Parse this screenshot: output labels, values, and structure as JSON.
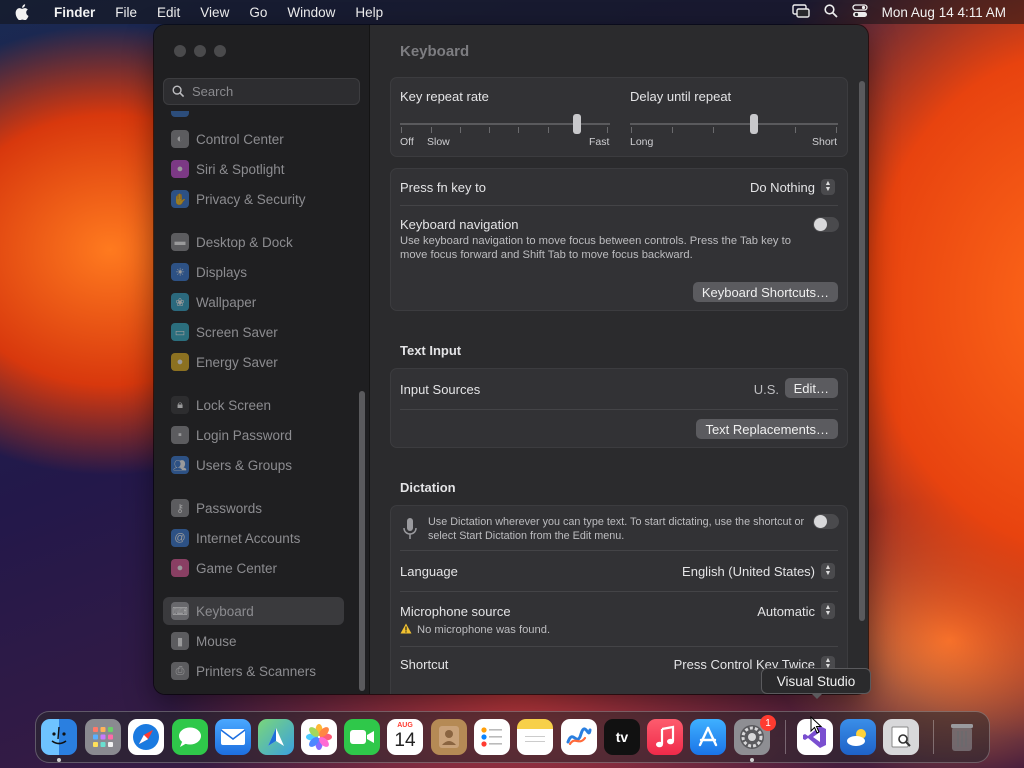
{
  "menubar": {
    "app": "Finder",
    "items": [
      "File",
      "Edit",
      "View",
      "Go",
      "Window",
      "Help"
    ],
    "clock": "Mon Aug 14  4:11 AM"
  },
  "sidebar": {
    "search_placeholder": "Search",
    "items": [
      {
        "label": "Control Center",
        "icon": "control-center-icon",
        "color": "#8e8e93"
      },
      {
        "label": "Siri & Spotlight",
        "icon": "siri-icon",
        "color": "#c84fd8"
      },
      {
        "label": "Privacy & Security",
        "icon": "hand-icon",
        "color": "#3a7bd5"
      },
      {
        "label": "Desktop & Dock",
        "icon": "dock-icon",
        "color": "#8e8e93"
      },
      {
        "label": "Displays",
        "icon": "sun-icon",
        "color": "#3a7bd5"
      },
      {
        "label": "Wallpaper",
        "icon": "wallpaper-icon",
        "color": "#35a7c9"
      },
      {
        "label": "Screen Saver",
        "icon": "screen-saver-icon",
        "color": "#35b0c9"
      },
      {
        "label": "Energy Saver",
        "icon": "bulb-icon",
        "color": "#e6b422"
      },
      {
        "label": "Lock Screen",
        "icon": "lock-icon",
        "color": "#3a3a3c"
      },
      {
        "label": "Login Password",
        "icon": "login-password-icon",
        "color": "#8e8e93"
      },
      {
        "label": "Users & Groups",
        "icon": "users-icon",
        "color": "#3a7bd5"
      },
      {
        "label": "Passwords",
        "icon": "key-icon",
        "color": "#8e8e93"
      },
      {
        "label": "Internet Accounts",
        "icon": "at-icon",
        "color": "#3a7bd5"
      },
      {
        "label": "Game Center",
        "icon": "game-center-icon",
        "color": "#e05a9a"
      },
      {
        "label": "Keyboard",
        "icon": "keyboard-icon",
        "color": "#8e8e93"
      },
      {
        "label": "Mouse",
        "icon": "mouse-icon",
        "color": "#8e8e93"
      },
      {
        "label": "Printers & Scanners",
        "icon": "printer-icon",
        "color": "#8e8e93"
      }
    ]
  },
  "content": {
    "title": "Keyboard",
    "key_repeat": {
      "label": "Key repeat rate",
      "off": "Off",
      "slow": "Slow",
      "fast": "Fast"
    },
    "delay_repeat": {
      "label": "Delay until repeat",
      "long": "Long",
      "short": "Short"
    },
    "fn_key": {
      "label": "Press fn key to",
      "value": "Do Nothing"
    },
    "keyboard_nav": {
      "label": "Keyboard navigation",
      "description": "Use keyboard navigation to move focus between controls. Press the Tab key to move focus forward and Shift Tab to move focus backward."
    },
    "shortcuts_button": "Keyboard Shortcuts…",
    "text_input": {
      "heading": "Text Input",
      "input_sources_label": "Input Sources",
      "input_sources_value": "U.S.",
      "edit_button": "Edit…",
      "replacements_button": "Text Replacements…"
    },
    "dictation": {
      "heading": "Dictation",
      "description": "Use Dictation wherever you can type text. To start dictating, use the shortcut or select Start Dictation from the Edit menu.",
      "language_label": "Language",
      "language_value": "English (United States)",
      "mic_label": "Microphone source",
      "mic_value": "Automatic",
      "mic_warning": "No microphone was found.",
      "shortcut_label": "Shortcut",
      "shortcut_value": "Press Control Key Twice"
    }
  },
  "tooltip": "Visual Studio",
  "dock": {
    "icons": [
      {
        "name": "finder",
        "glyph": "☺",
        "color": "#2e8cf0",
        "running": true
      },
      {
        "name": "launchpad",
        "glyph": "▦",
        "color": "#8e8e93",
        "running": false
      },
      {
        "name": "safari",
        "glyph": "✦",
        "color": "#1f7ae0",
        "running": false
      },
      {
        "name": "messages",
        "glyph": "●",
        "color": "#2fc84a",
        "running": false
      },
      {
        "name": "mail",
        "glyph": "✉",
        "color": "#2a86e8",
        "running": false
      },
      {
        "name": "maps",
        "glyph": "➤",
        "color": "#4caf50",
        "running": false
      },
      {
        "name": "photos",
        "glyph": "✿",
        "color": "#f2f2f2",
        "running": false
      },
      {
        "name": "facetime",
        "glyph": "▶",
        "color": "#2fc84a",
        "running": false
      },
      {
        "name": "calendar",
        "glyph": "14",
        "color": "#ffffff",
        "running": false
      },
      {
        "name": "contacts",
        "glyph": "☻",
        "color": "#b58a55",
        "running": false
      },
      {
        "name": "reminders",
        "glyph": "☰",
        "color": "#ffffff",
        "running": false
      },
      {
        "name": "notes",
        "glyph": "▤",
        "color": "#f7d04a",
        "running": false
      },
      {
        "name": "freeform",
        "glyph": "∿",
        "color": "#ffffff",
        "running": false
      },
      {
        "name": "apple-tv",
        "glyph": "tv",
        "color": "#111111",
        "running": false
      },
      {
        "name": "music",
        "glyph": "♫",
        "color": "#fa3c55",
        "running": false
      },
      {
        "name": "app-store",
        "glyph": "A",
        "color": "#1e8cf0",
        "running": false
      },
      {
        "name": "system-settings",
        "glyph": "⚙",
        "color": "#8e8e93",
        "running": true,
        "badge": "1"
      },
      {
        "name": "visual-studio",
        "glyph": "◆",
        "color": "#7a4fd0",
        "running": false
      },
      {
        "name": "weather",
        "glyph": "☁",
        "color": "#3a8ee8",
        "running": false
      },
      {
        "name": "preview",
        "glyph": "▣",
        "color": "#d8d8da",
        "running": false
      },
      {
        "name": "trash",
        "glyph": "🗑",
        "color": "#6a6a6e",
        "running": false
      }
    ],
    "calendar_month": "AUG",
    "calendar_day": "14"
  }
}
